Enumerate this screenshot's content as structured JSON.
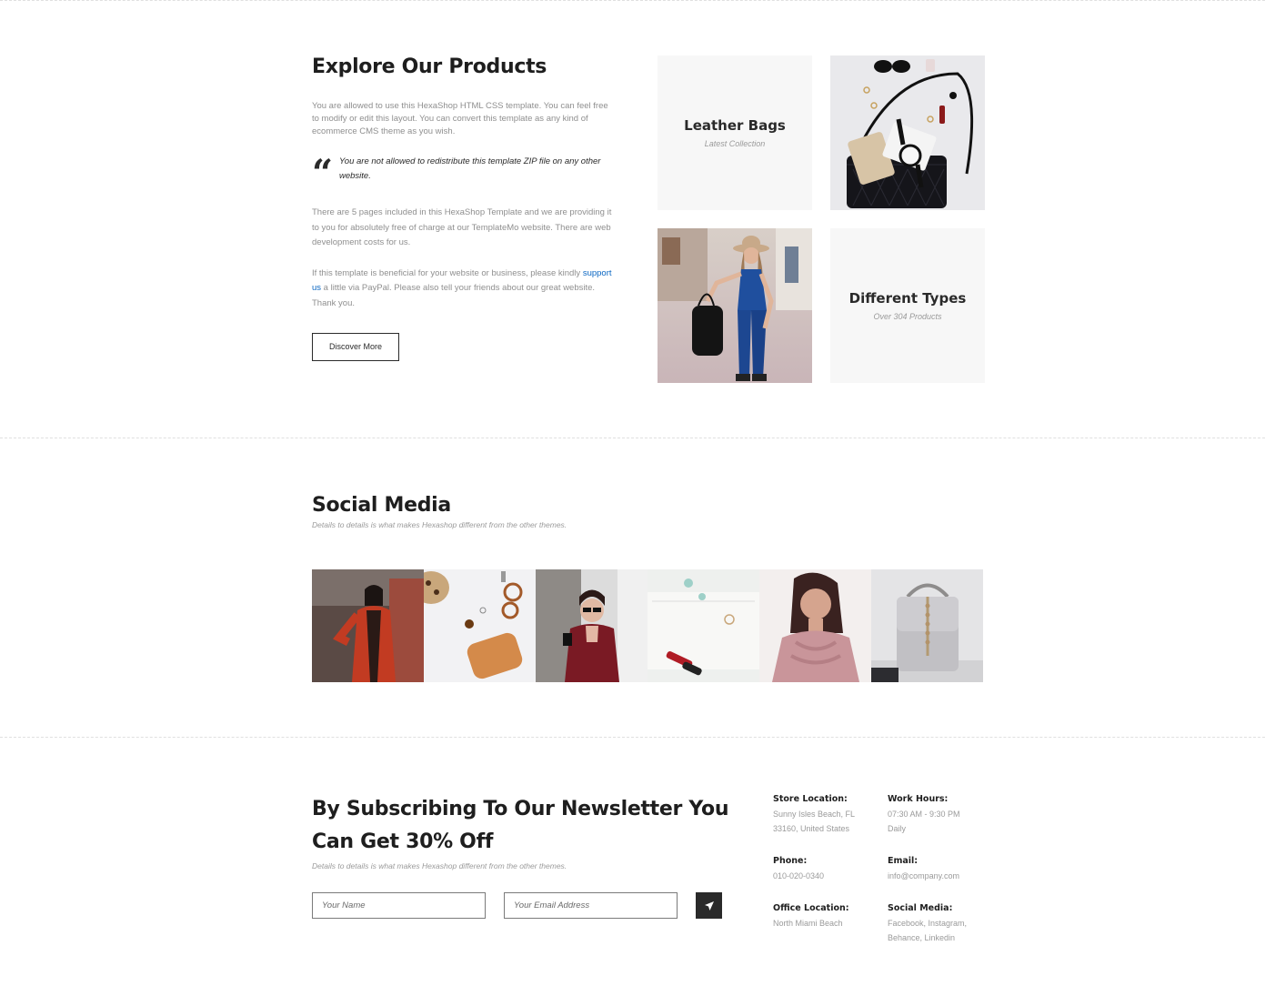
{
  "explore": {
    "title": "Explore Our Products",
    "paragraph1": "You are allowed to use this HexaShop HTML CSS template. You can feel free to modify or edit this layout. You can convert this template as any kind of ecommerce CMS theme as you wish.",
    "quote_mark": "“",
    "quote": "You are not allowed to redistribute this template ZIP file on any other website.",
    "paragraph2": "There are 5 pages included in this HexaShop Template and we are providing it to you for absolutely free of charge at our TemplateMo website. There are web development costs for us.",
    "paragraph3_before": "If this template is beneficial for your website or business, please kindly ",
    "paragraph3_link": "support us",
    "paragraph3_after": " a little via PayPal. Please also tell your friends about our great website. Thank you.",
    "button": "Discover More",
    "tiles": {
      "leather": {
        "title": "Leather Bags",
        "subtitle": "Latest Collection"
      },
      "types": {
        "title": "Different Types",
        "subtitle": "Over 304 Products"
      }
    }
  },
  "social": {
    "title": "Social Media",
    "subtitle": "Details to details is what makes Hexashop different from the other themes."
  },
  "newsletter": {
    "title": "By Subscribing To Our Newsletter You Can Get 30% Off",
    "subtitle": "Details to details is what makes Hexashop different from the other themes.",
    "name_placeholder": "Your Name",
    "email_placeholder": "Your Email Address"
  },
  "info": {
    "store": {
      "label": "Store Location:",
      "line1": "Sunny Isles Beach, FL",
      "line2": "33160, United States"
    },
    "hours": {
      "label": "Work Hours:",
      "line1": "07:30 AM - 9:30 PM",
      "line2": "Daily"
    },
    "phone": {
      "label": "Phone:",
      "line1": "010-020-0340"
    },
    "email": {
      "label": "Email:",
      "line1": "info@company.com"
    },
    "office": {
      "label": "Office Location:",
      "line1": "North Miami Beach"
    },
    "socialmedia": {
      "label": "Social Media:",
      "line1": "Facebook, Instagram,",
      "line2": "Behance, Linkedin"
    }
  },
  "colors": {
    "dark": "#2a2a2a",
    "muted": "#8f8f8f",
    "link": "#0a66c2",
    "tile_bg": "#f7f7f7"
  }
}
